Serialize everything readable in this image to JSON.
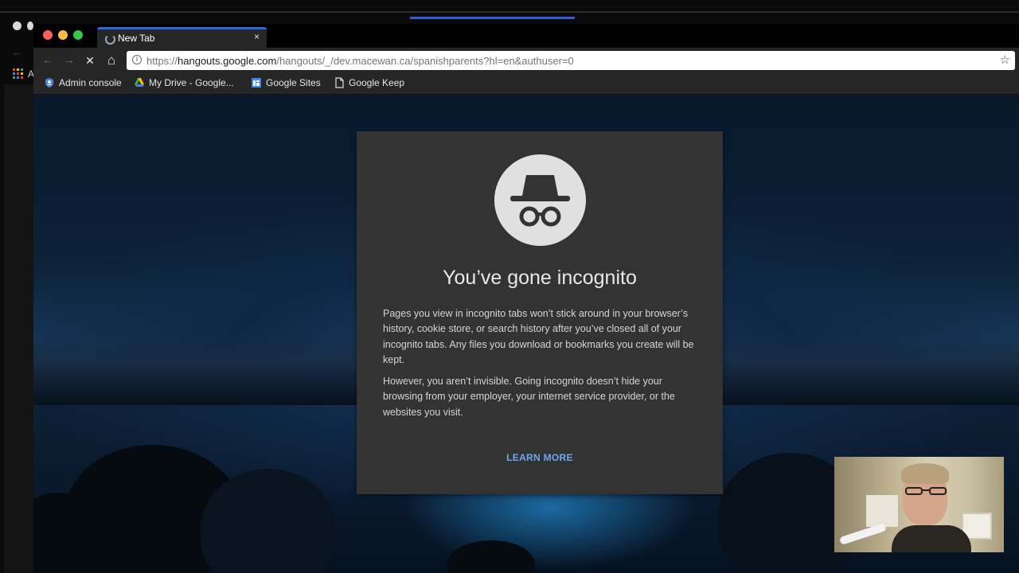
{
  "background_window": {
    "apps_letter": "A"
  },
  "tab": {
    "title": "New Tab",
    "close_glyph": "×"
  },
  "toolbar": {
    "back_glyph": "←",
    "forward_glyph": "→",
    "stop_glyph": "✕",
    "home_glyph": "⌂",
    "info_glyph": "i",
    "url_scheme": "https://",
    "url_host": "hangouts.google.com",
    "url_rest": "/hangouts/_/dev.macewan.ca/spanishparents?hl=en&authuser=0",
    "star_glyph": "☆"
  },
  "bookmarks": [
    {
      "label": "Admin console",
      "icon": "admin-console-icon"
    },
    {
      "label": "My Drive - Google...",
      "icon": "google-drive-icon"
    },
    {
      "label": "Google Sites",
      "icon": "google-sites-icon"
    },
    {
      "label": "Google Keep",
      "icon": "document-icon"
    }
  ],
  "incognito": {
    "title": "You’ve gone incognito",
    "para1": "Pages you view in incognito tabs won’t stick around in your browser’s history, cookie store, or search history after you’ve closed all of your incognito tabs. Any files you download or bookmarks you create will be kept.",
    "para2": "However, you aren’t invisible. Going incognito doesn’t hide your browsing from your employer, your internet service provider, or the websites you visit.",
    "learn_more": "LEARN MORE",
    "icon": "incognito-icon"
  },
  "colors": {
    "card_bg": "#333333",
    "link": "#6ea6f0",
    "tab_indicator": "#2f66e0",
    "traffic_close": "#fc605c",
    "traffic_min": "#fdbc40",
    "traffic_max": "#34c84a"
  }
}
